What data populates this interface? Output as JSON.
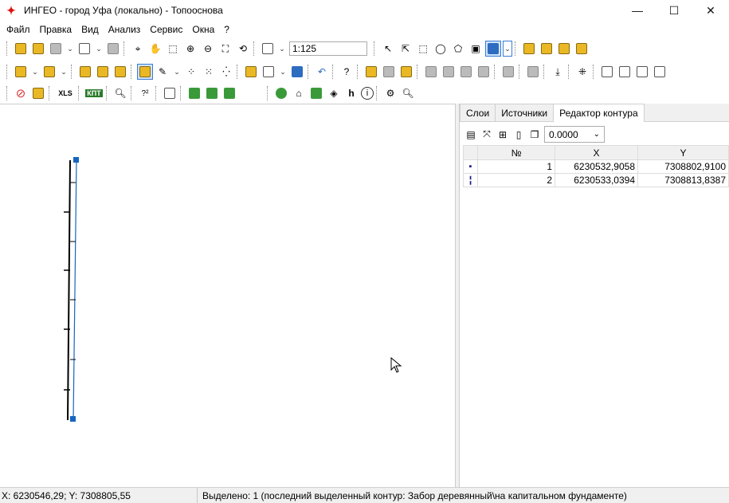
{
  "titlebar": {
    "title": "ИНГЕО - город Уфа (локально) - Топооснова",
    "app_icon": "ingeo-logo-icon",
    "minimize": "—",
    "maximize": "☐",
    "close": "✕"
  },
  "menu": [
    "Файл",
    "Правка",
    "Вид",
    "Анализ",
    "Сервис",
    "Окна",
    "?"
  ],
  "toolbar": {
    "scale_value": "1:125",
    "xls_label": "XLS",
    "kpt_label": "КПТ"
  },
  "panel": {
    "tabs": [
      "Слои",
      "Источники",
      "Редактор контура"
    ],
    "active_tab": "Редактор контура",
    "precision_value": "0.0000",
    "columns": [
      "№",
      "X",
      "Y"
    ],
    "rows": [
      {
        "num": "1",
        "x": "6230532,9058",
        "y": "7308802,9100"
      },
      {
        "num": "2",
        "x": "6230533,0394",
        "y": "7308813,8387"
      }
    ]
  },
  "status": {
    "coords": "X: 6230546,29; Y: 7308805,55",
    "selection": "Выделено: 1 (последний выделенный контур: Забор деревянный\\на капитальном фундаменте)"
  },
  "colors": {
    "accent": "#3a7bd5",
    "vertex": "#1565c0",
    "line": "#000000"
  }
}
